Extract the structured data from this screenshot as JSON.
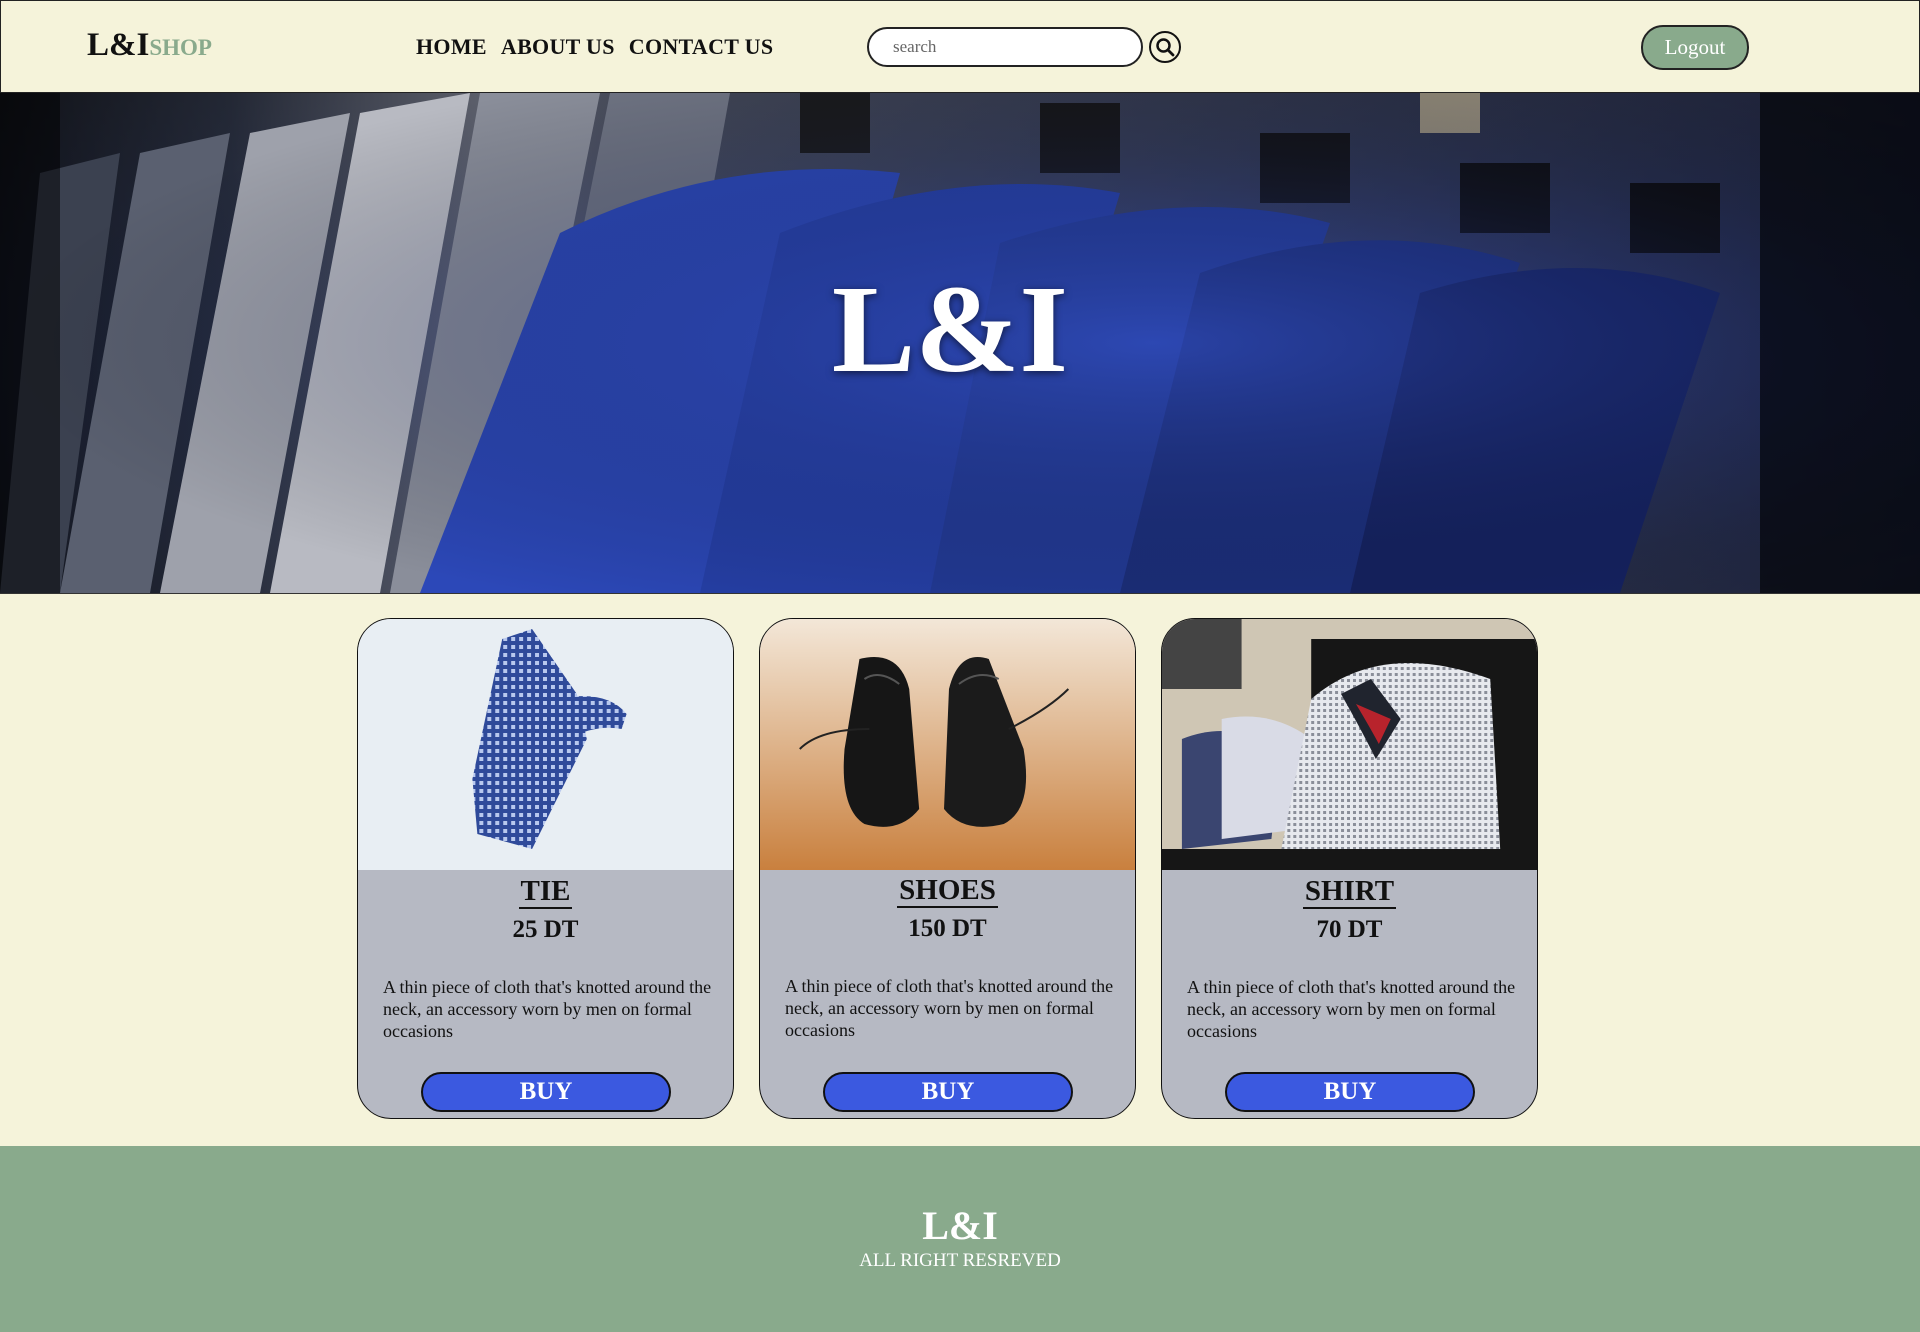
{
  "header": {
    "logo_main": "L&I",
    "logo_sub": "SHOP",
    "nav": [
      "HOME",
      "ABOUT US",
      "CONTACT US"
    ],
    "search_placeholder": "search",
    "search_icon": "magnifier-icon",
    "logout_label": "Logout"
  },
  "hero": {
    "title": "L&I"
  },
  "products": [
    {
      "name": "TIE",
      "price": "25 DT",
      "description": "A thin piece of cloth that's knotted around the neck, an accessory worn by men on formal occasions",
      "buy_label": "BUY"
    },
    {
      "name": "SHOES",
      "price": "150 DT",
      "description": "A thin piece of cloth that's knotted around the neck, an accessory worn by men on formal occasions",
      "buy_label": "BUY"
    },
    {
      "name": "SHIRT",
      "price": "70 DT",
      "description": "A thin piece of cloth that's knotted around the neck, an accessory worn by men on formal occasions",
      "buy_label": "BUY"
    }
  ],
  "footer": {
    "logo": "L&I",
    "text": "ALL RIGHT RESREVED"
  },
  "colors": {
    "background": "#f5f3da",
    "accent_green": "#89aa8c",
    "buy_blue": "#3b59e0",
    "card_gray": "#b6b9c3"
  }
}
